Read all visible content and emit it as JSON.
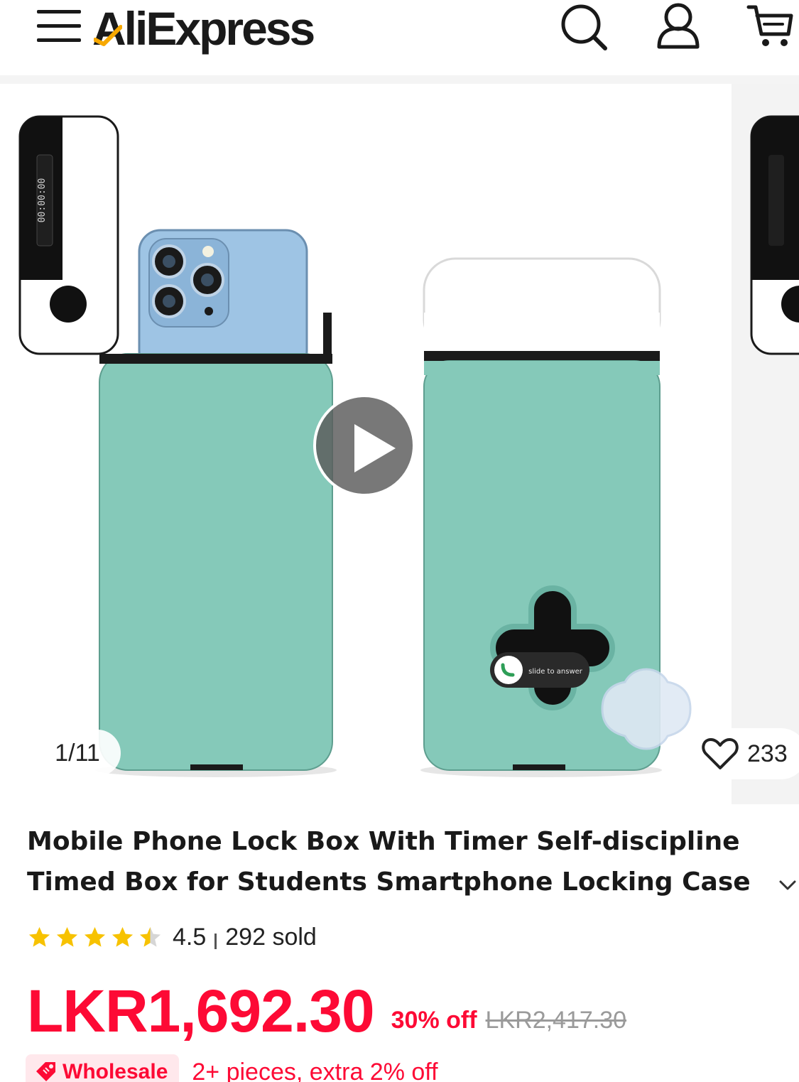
{
  "header": {
    "logo_text": "AliExpress",
    "menu_icon": "hamburger-menu-icon",
    "search_icon": "search-icon",
    "account_icon": "user-icon",
    "cart_icon": "cart-icon"
  },
  "gallery": {
    "counter": "1/11",
    "wishlist_count": "233",
    "play_icon": "play-icon",
    "product_colors": {
      "case_teal": "#85c9b9",
      "cap_white": "#ffffff",
      "phone_blue": "#9ec4e4"
    },
    "screen_text": "slide to answer",
    "timer_digits": "00:00:00"
  },
  "product": {
    "title": "Mobile Phone Lock Box With Timer Self-discipline Timed Box for Students Smartphone Locking Case Safe Timed",
    "rating": "4.5",
    "stars_value": 4.5,
    "sold": "292 sold",
    "price": "LKR1,692.30",
    "discount": "30% off",
    "original_price": "LKR2,417.30"
  },
  "wholesale": {
    "label": "Wholesale",
    "text": "2+ pieces, extra 2% off"
  },
  "colors": {
    "price_red": "#fd0a35",
    "star_gold": "#f7c200",
    "text_dark": "#191919"
  }
}
